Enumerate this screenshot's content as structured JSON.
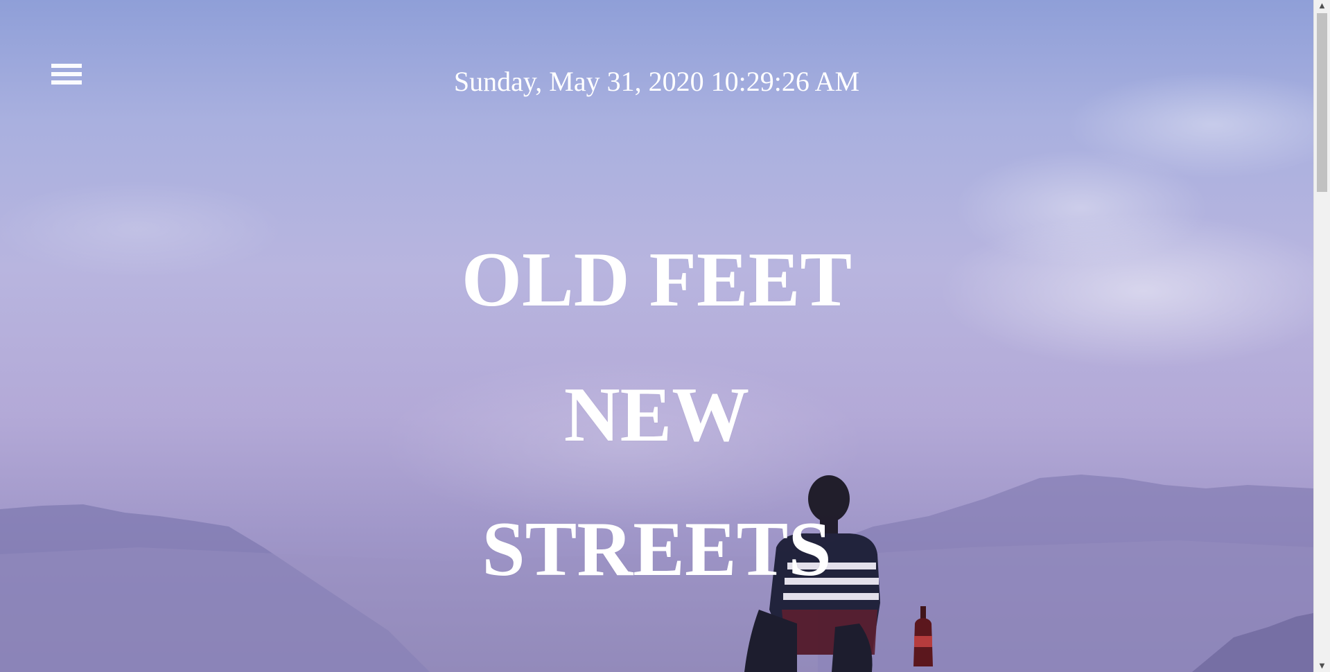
{
  "header": {
    "menu_icon": "hamburger-menu-icon",
    "datetime": "Sunday, May 31, 2020 10:29:26 AM"
  },
  "hero": {
    "title_lines": [
      "OLD FEET",
      "NEW",
      "STREETS"
    ],
    "background": "sky-mountains-person-photo"
  },
  "scrollbar": {
    "up_arrow": "▲",
    "down_arrow": "▼",
    "position": 0.0
  },
  "colors": {
    "text": "#ffffff",
    "sky_top": "#8f9fd8",
    "sky_bottom": "#8f86b6"
  }
}
